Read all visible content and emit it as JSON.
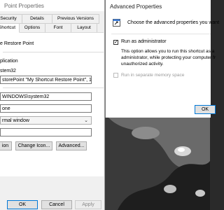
{
  "properties_dialog": {
    "title": "Point Properties",
    "tabs_row1": [
      "Security",
      "Details",
      "Previous Versions"
    ],
    "tabs_row2": [
      "Shortcut",
      "Options",
      "Font",
      "Layout"
    ],
    "shortcut_name": "e Restore Point",
    "target_type_value": "plication",
    "target_location_value": "stem32",
    "target_value": "storePoint \"My Shortcut Restore Point\", 100, 7\"",
    "start_in_value": "WINDOWS\\system32",
    "shortcut_key_value": "one",
    "run_value": "rmal window",
    "comment_value": "",
    "open_file_location_label": "ion",
    "change_icon_label": "Change Icon...",
    "advanced_label": "Advanced...",
    "ok_label": "OK",
    "cancel_label": "Cancel",
    "apply_label": "Apply"
  },
  "advanced_dialog": {
    "title": "Advanced Properties",
    "heading": "Choose the advanced properties you want",
    "run_as_admin_label": "Run as administrator",
    "run_as_admin_checked": true,
    "description_lines": [
      "This option allows you to run this shortcut as a",
      "administrator, while protecting your computer fr",
      "unauthorized activity."
    ],
    "separate_memory_label": "Run in separate memory space",
    "separate_memory_enabled": false,
    "ok_label": "OK"
  }
}
